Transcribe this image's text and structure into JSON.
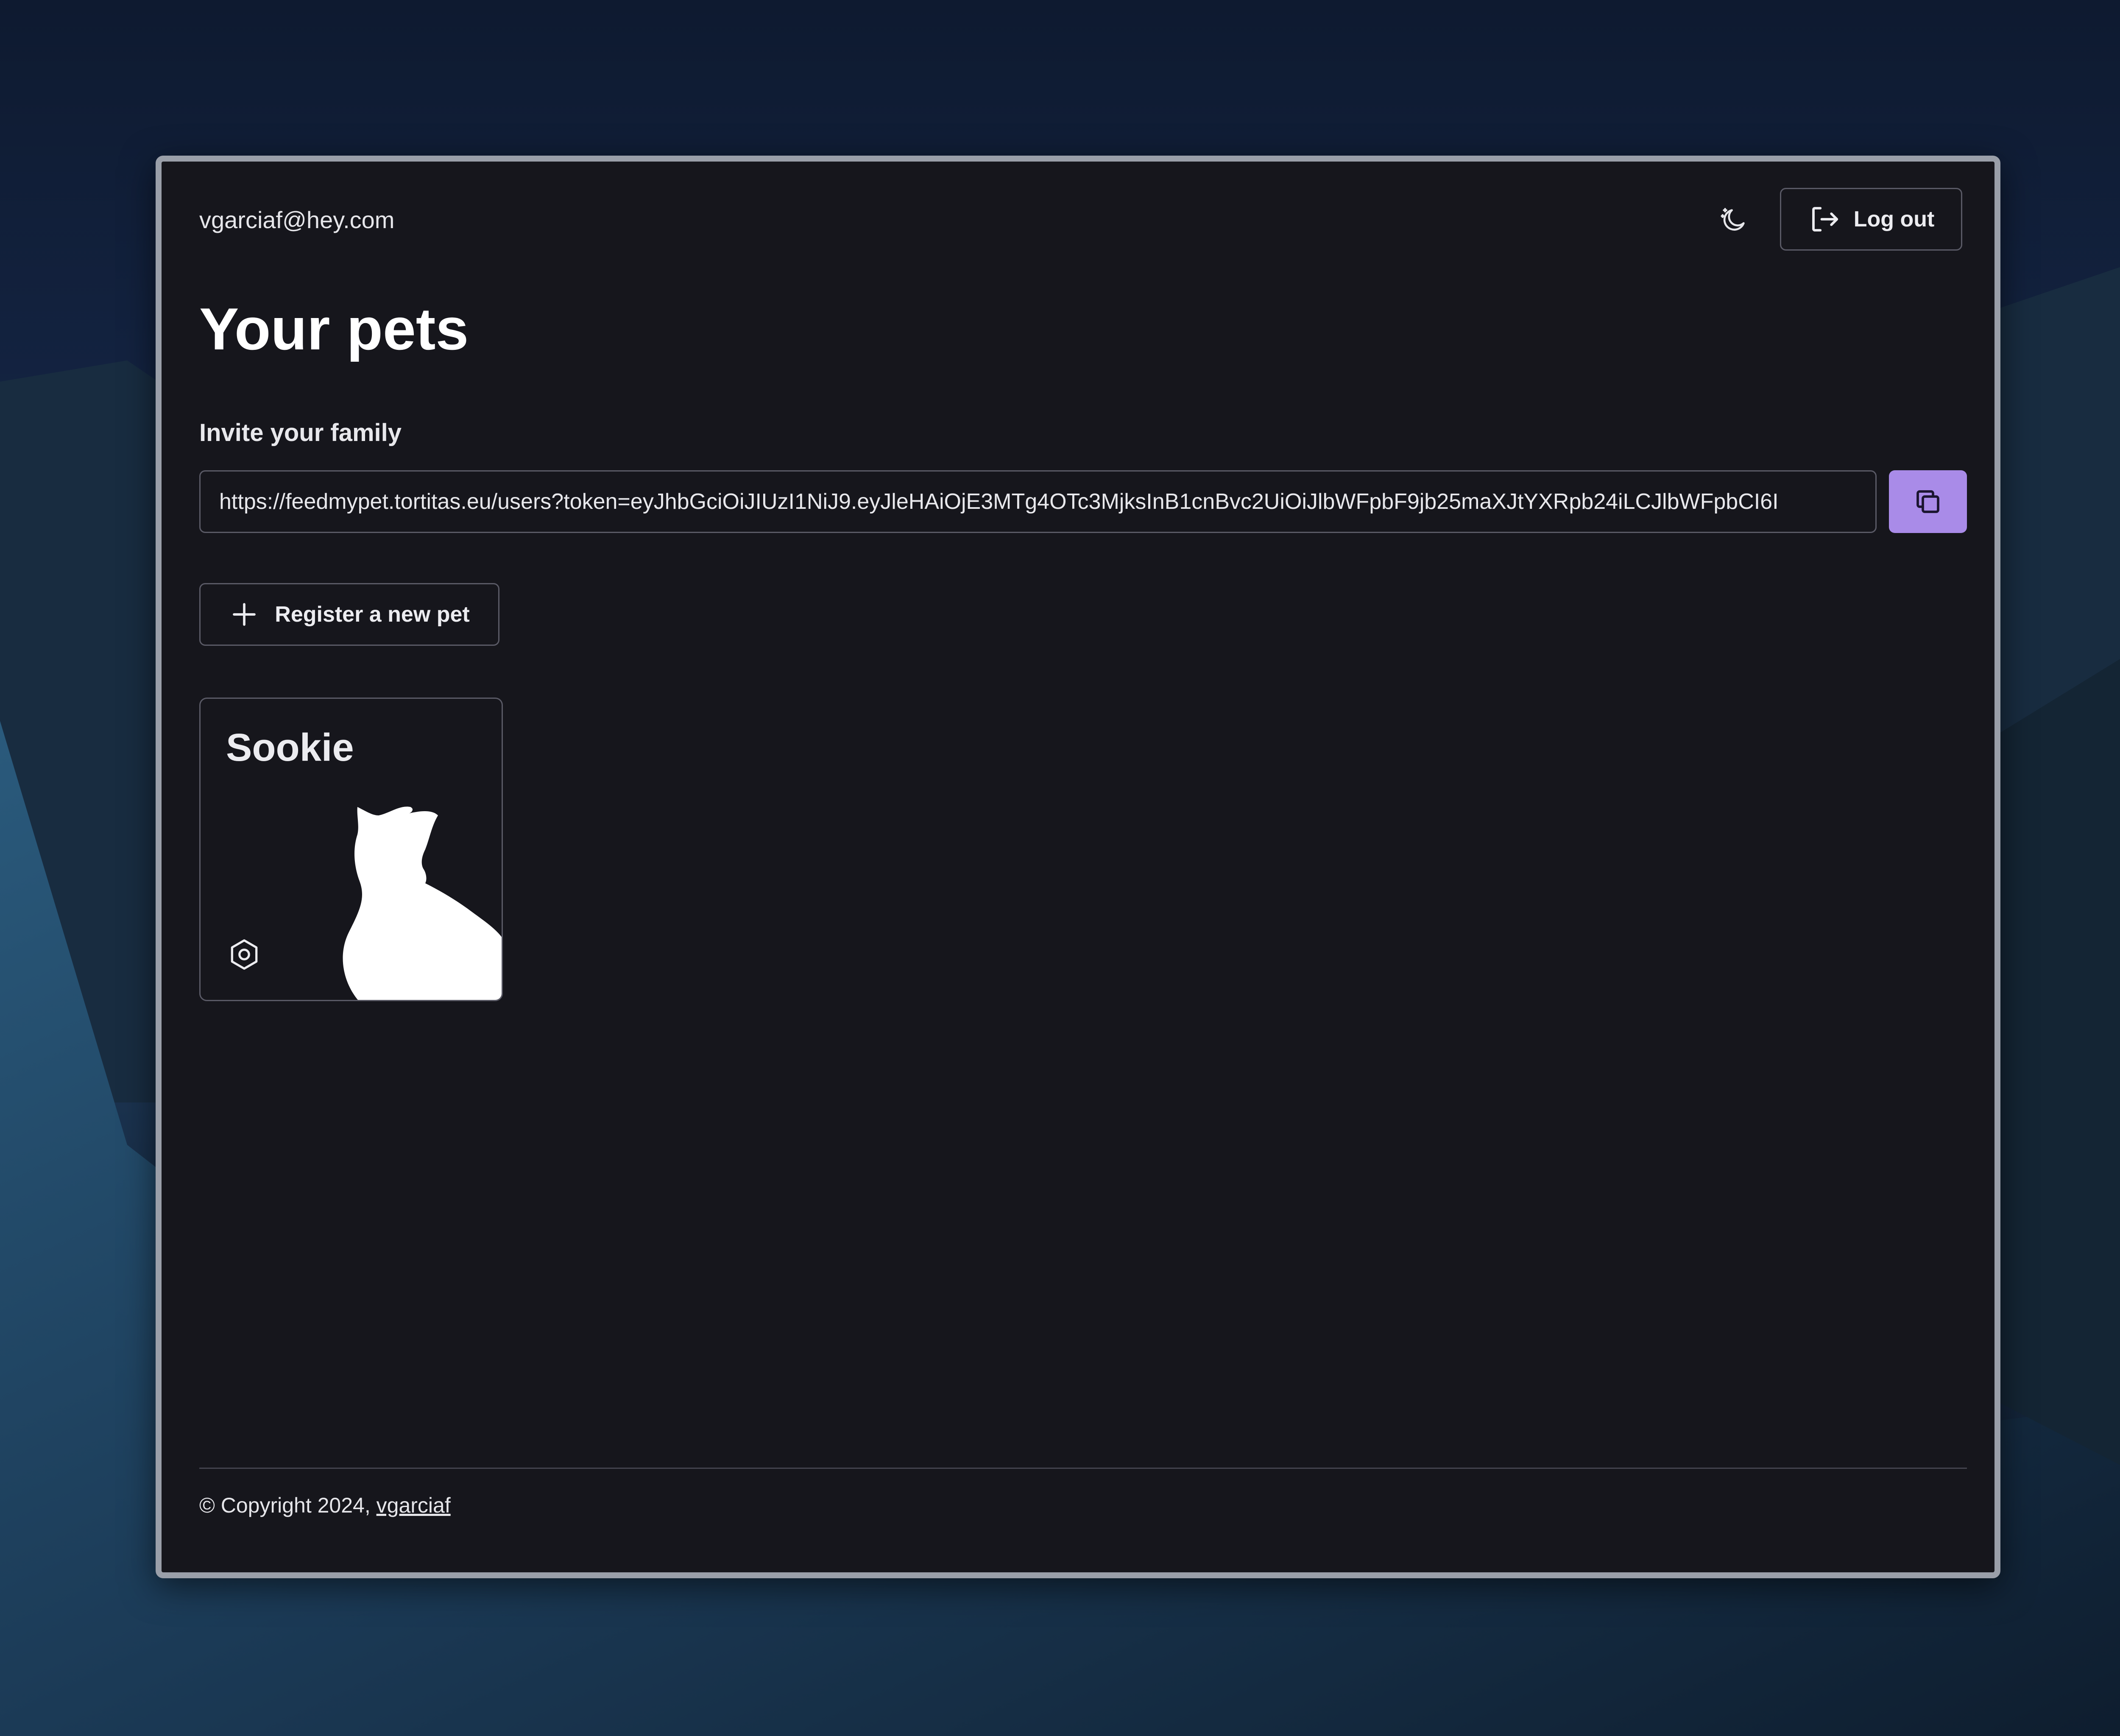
{
  "header": {
    "user_email": "vgarciaf@hey.com",
    "theme_icon": "moon-sparkle-icon",
    "logout_label": "Log out",
    "logout_icon": "logout-icon"
  },
  "main": {
    "title": "Your pets",
    "invite": {
      "label": "Invite your family",
      "url": "https://feedmypet.tortitas.eu/users?token=eyJhbGciOiJIUzI1NiJ9.eyJleHAiOjE3MTg4OTc3MjksInB1cnBvc2UiOiJlbWFpbF9jb25maXJtYXRpb24iLCJlbWFpbCI6I",
      "copy_icon": "copy-icon"
    },
    "register_button": {
      "label": "Register a new pet",
      "icon": "plus-icon"
    },
    "pets": [
      {
        "name": "Sookie",
        "image_icon": "cat-silhouette-icon",
        "settings_icon": "gear-icon"
      }
    ]
  },
  "footer": {
    "copyright": "© Copyright 2024, ",
    "author_link": "vgarciaf"
  },
  "colors": {
    "window_bg": "#16161c",
    "accent": "#a98be8",
    "border": "#5a5a66",
    "text": "#e6e6ea"
  }
}
